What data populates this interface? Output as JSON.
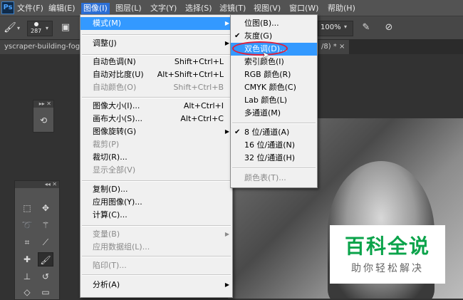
{
  "app": {
    "logo": "Ps"
  },
  "menubar": {
    "items": [
      {
        "label": "文件(F)"
      },
      {
        "label": "编辑(E)"
      },
      {
        "label": "图像(I)"
      },
      {
        "label": "图层(L)"
      },
      {
        "label": "文字(Y)"
      },
      {
        "label": "选择(S)"
      },
      {
        "label": "滤镜(T)"
      },
      {
        "label": "视图(V)"
      },
      {
        "label": "窗口(W)"
      },
      {
        "label": "帮助(H)"
      }
    ],
    "active_index": 2
  },
  "options_bar": {
    "brush_size": "287",
    "zoom": "100%"
  },
  "document_tabs": [
    {
      "label": "yscraper-building-fog.jp"
    },
    {
      "label": "/8) * ×"
    }
  ],
  "image_menu": {
    "items": [
      {
        "label": "模式(M)",
        "shortcut": "",
        "submenu": true,
        "highlighted": true,
        "disabled": false
      },
      {
        "label": "调整(J)",
        "shortcut": "",
        "submenu": true,
        "disabled": false
      },
      {
        "label": "自动色调(N)",
        "shortcut": "Shift+Ctrl+L",
        "disabled": false
      },
      {
        "label": "自动对比度(U)",
        "shortcut": "Alt+Shift+Ctrl+L",
        "disabled": false
      },
      {
        "label": "自动颜色(O)",
        "shortcut": "Shift+Ctrl+B",
        "disabled": true
      },
      {
        "label": "图像大小(I)...",
        "shortcut": "Alt+Ctrl+I",
        "disabled": false
      },
      {
        "label": "画布大小(S)...",
        "shortcut": "Alt+Ctrl+C",
        "disabled": false
      },
      {
        "label": "图像旋转(G)",
        "shortcut": "",
        "submenu": true,
        "disabled": false
      },
      {
        "label": "裁剪(P)",
        "shortcut": "",
        "disabled": true
      },
      {
        "label": "裁切(R)...",
        "shortcut": "",
        "disabled": false
      },
      {
        "label": "显示全部(V)",
        "shortcut": "",
        "disabled": true
      },
      {
        "label": "复制(D)...",
        "shortcut": "",
        "disabled": false
      },
      {
        "label": "应用图像(Y)...",
        "shortcut": "",
        "disabled": false
      },
      {
        "label": "计算(C)...",
        "shortcut": "",
        "disabled": false
      },
      {
        "label": "变量(B)",
        "shortcut": "",
        "submenu": true,
        "disabled": true
      },
      {
        "label": "应用数据组(L)...",
        "shortcut": "",
        "disabled": true
      },
      {
        "label": "陷印(T)...",
        "shortcut": "",
        "disabled": true
      },
      {
        "label": "分析(A)",
        "shortcut": "",
        "submenu": true,
        "disabled": false
      }
    ]
  },
  "mode_submenu": {
    "items": [
      {
        "label": "位图(B)...",
        "checked": false,
        "disabled": false
      },
      {
        "label": "灰度(G)",
        "checked": true,
        "disabled": false
      },
      {
        "label": "双色调(D)...",
        "checked": false,
        "disabled": false,
        "highlighted": true
      },
      {
        "label": "索引颜色(I)",
        "checked": false,
        "disabled": false
      },
      {
        "label": "RGB 颜色(R)",
        "checked": false,
        "disabled": false
      },
      {
        "label": "CMYK 颜色(C)",
        "checked": false,
        "disabled": false
      },
      {
        "label": "Lab 颜色(L)",
        "checked": false,
        "disabled": false
      },
      {
        "label": "多通道(M)",
        "checked": false,
        "disabled": false
      },
      {
        "label": "8 位/通道(A)",
        "checked": true,
        "disabled": false
      },
      {
        "label": "16 位/通道(N)",
        "checked": false,
        "disabled": false
      },
      {
        "label": "32 位/通道(H)",
        "checked": false,
        "disabled": false
      },
      {
        "label": "颜色表(T)...",
        "checked": false,
        "disabled": true
      }
    ],
    "check_glyph": "✔"
  },
  "watermark": {
    "title": "百科全说",
    "subtitle": "助你轻松解决"
  },
  "colors": {
    "accent": "#3399ff",
    "highlight_ring": "#e0203a",
    "watermark_green": "#0aa34a"
  },
  "icons": [
    "brush-icon",
    "gear-icon",
    "airbrush-icon",
    "pressure-icon",
    "marquee-icon",
    "move-icon",
    "lasso-icon",
    "magic-wand-icon",
    "crop-icon",
    "eyedropper-icon",
    "healing-icon",
    "brush-tool-icon",
    "stamp-icon",
    "history-brush-icon",
    "eraser-icon",
    "gradient-icon"
  ]
}
